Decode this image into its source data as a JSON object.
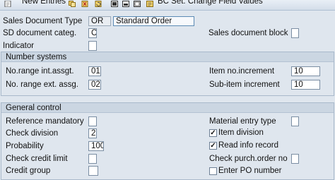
{
  "toolbar": {
    "new_entries_label": "New Entries",
    "bc_set_label": "BC Set: Change Field Values",
    "icons": [
      "new-entries-icon",
      "copy-icon",
      "delete-icon",
      "undo-icon",
      "select-all-icon",
      "select-block-icon",
      "deselect-all-icon",
      "bc-set-icon"
    ]
  },
  "header": {
    "sales_doc_type_label": "Sales Document Type",
    "sales_doc_type_value": "OR",
    "sales_doc_type_desc": "Standard Order",
    "sd_doc_categ_label": "SD document categ.",
    "sd_doc_categ_value": "C",
    "indicator_label": "Indicator",
    "indicator_value": "",
    "sales_doc_block_label": "Sales document block",
    "sales_doc_block_value": ""
  },
  "number_systems": {
    "title": "Number systems",
    "no_range_int_label": "No.range int.assgt.",
    "no_range_int_value": "01",
    "no_range_ext_label": "No. range ext. assg.",
    "no_range_ext_value": "02",
    "item_no_incr_label": "Item no.increment",
    "item_no_incr_value": "10",
    "sub_item_incr_label": "Sub-item increment",
    "sub_item_incr_value": "10"
  },
  "general_control": {
    "title": "General control",
    "reference_mandatory_label": "Reference mandatory",
    "reference_mandatory_value": "",
    "check_division_label": "Check division",
    "check_division_value": "2",
    "probability_label": "Probability",
    "probability_value": "100",
    "check_credit_limit_label": "Check credit limit",
    "check_credit_limit_value": "",
    "credit_group_label": "Credit group",
    "credit_group_value": "",
    "material_entry_type_label": "Material entry type",
    "material_entry_type_value": "",
    "item_division_label": "Item division",
    "item_division_checked": true,
    "read_info_record_label": "Read info record",
    "read_info_record_checked": true,
    "check_purch_order_label": "Check purch.order no",
    "check_purch_order_value": "",
    "enter_po_number_label": "Enter PO number",
    "enter_po_number_checked": false
  }
}
